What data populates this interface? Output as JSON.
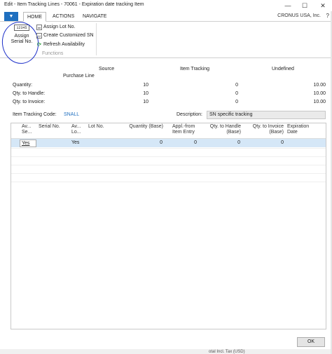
{
  "window": {
    "title": "Edit - Item Tracking Lines - 70061 - Expiration date tracking Item",
    "minimize": "—",
    "maximize": "☐",
    "close": "✕"
  },
  "ribbon": {
    "tabs": [
      "HOME",
      "ACTIONS",
      "NAVIGATE"
    ],
    "company": "CRONUS USA, Inc.",
    "help": "?",
    "big_button": {
      "icon_text": "12345",
      "label_line1": "Assign",
      "label_line2": "Serial No."
    },
    "small_buttons": [
      "Assign Lot No.",
      "Create Customized SN",
      "Refresh Availability"
    ],
    "group_label": "Functions"
  },
  "summary": {
    "col_source": "Source",
    "col_tracking": "Item Tracking",
    "col_undefined": "Undefined",
    "sub_source": "Purchase Line",
    "rows": [
      {
        "label": "Quantity:",
        "source": "10",
        "tracking": "0",
        "undefined": "10.00"
      },
      {
        "label": "Qty. to Handle:",
        "source": "10",
        "tracking": "0",
        "undefined": "10.00"
      },
      {
        "label": "Qty. to Invoice:",
        "source": "10",
        "tracking": "0",
        "undefined": "10.00"
      }
    ]
  },
  "tracking_code": {
    "label": "Item Tracking Code:",
    "value": "SNALL"
  },
  "description": {
    "label": "Description:",
    "value": "SN specific tracking"
  },
  "grid": {
    "headers": {
      "avail_serial_1": "Av...",
      "avail_serial_2": "Se...",
      "serial_no": "Serial No.",
      "avail_lot_1": "Av...",
      "avail_lot_2": "Lo...",
      "lot_no": "Lot No.",
      "quantity_base": "Quantity (Base)",
      "appl_from_1": "Appl.-from",
      "appl_from_2": "Item Entry",
      "qty_handle_1": "Qty. to Handle",
      "qty_handle_2": "(Base)",
      "qty_invoice_1": "Qty. to Invoice",
      "qty_invoice_2": "(Base)",
      "expiration_1": "Expiration",
      "expiration_2": "Date"
    },
    "row": {
      "avail_serial": "Yes",
      "serial_no": "",
      "avail_lot": "Yes",
      "lot_no": "",
      "quantity_base": "0",
      "appl_from": "0",
      "qty_handle": "0",
      "qty_invoice": "0",
      "expiration": ""
    }
  },
  "footer": {
    "ok": "OK",
    "partial_text": "otal Incl. Tax (USD)"
  }
}
